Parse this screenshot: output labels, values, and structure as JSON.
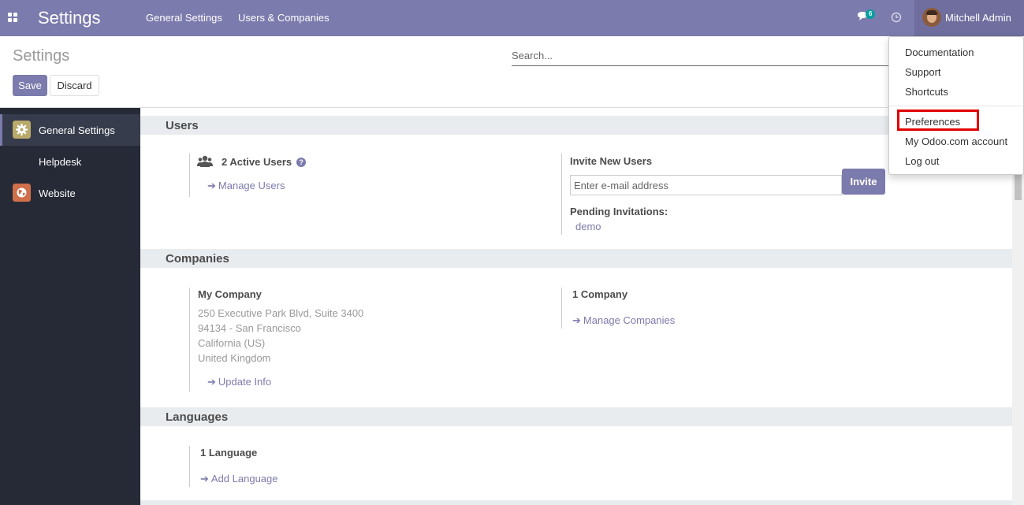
{
  "navbar": {
    "brand": "Settings",
    "menu": [
      "General Settings",
      "Users & Companies"
    ],
    "chat_count": "6",
    "user_name": "Mitchell Admin",
    "bg_color": "#7c7bad"
  },
  "control_panel": {
    "title": "Settings",
    "save_label": "Save",
    "discard_label": "Discard",
    "search_placeholder": "Search..."
  },
  "sidebar": {
    "items": [
      {
        "label": "General Settings",
        "icon": "gear-icon",
        "active": true
      },
      {
        "label": "Helpdesk",
        "icon": "",
        "active": false
      },
      {
        "label": "Website",
        "icon": "globe-icon",
        "active": false
      }
    ]
  },
  "users_section": {
    "title": "Users",
    "active_users": "2 Active Users",
    "manage_users": "Manage Users",
    "invite_title": "Invite New Users",
    "email_placeholder": "Enter e-mail address",
    "invite_label": "Invite",
    "pending_title": "Pending Invitations:",
    "pending_users": [
      "demo"
    ]
  },
  "companies_section": {
    "title": "Companies",
    "company_name": "My Company",
    "address": [
      "250 Executive Park Blvd, Suite 3400",
      "94134 - San Francisco",
      "California (US)",
      "United Kingdom"
    ],
    "update_info": "Update Info",
    "company_count": "1 Company",
    "manage_companies": "Manage Companies"
  },
  "languages_section": {
    "title": "Languages",
    "language_count": "1 Language",
    "add_language": "Add Language"
  },
  "user_menu": {
    "items": [
      "Documentation",
      "Support",
      "Shortcuts",
      "Preferences",
      "My Odoo.com account",
      "Log out"
    ],
    "highlighted": "Preferences"
  }
}
